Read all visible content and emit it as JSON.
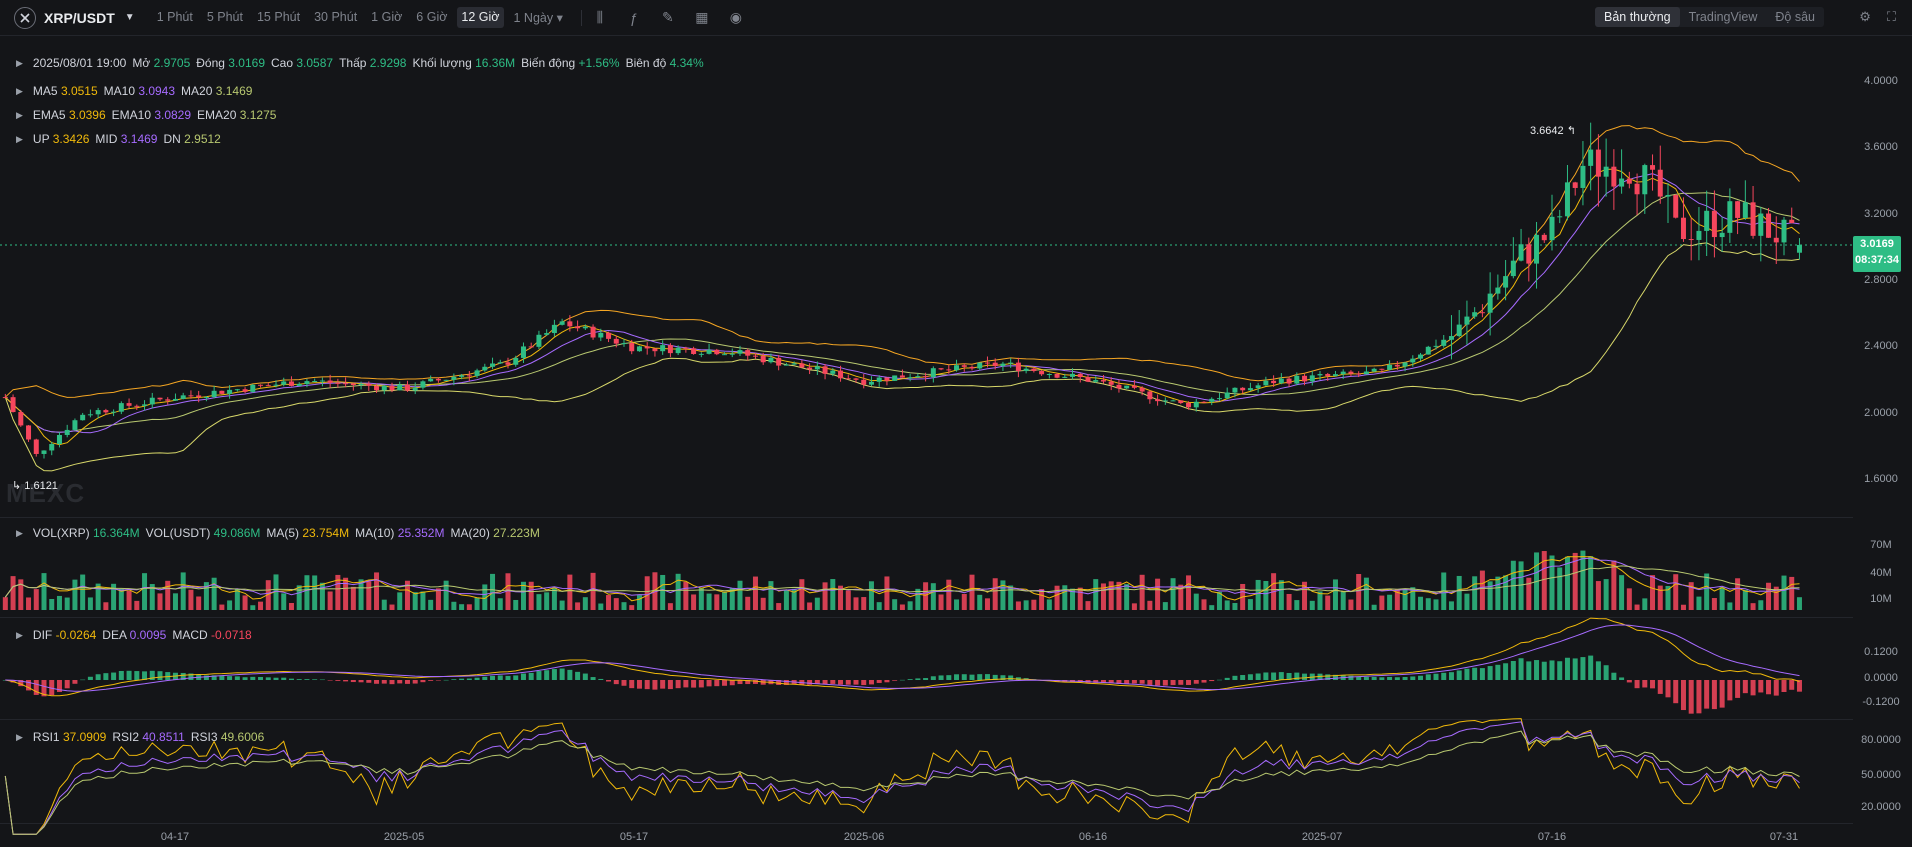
{
  "header": {
    "pair": "XRP/USDT",
    "intervals": [
      "1 Phút",
      "5 Phút",
      "15 Phút",
      "30 Phút",
      "1 Giờ",
      "6 Giờ",
      "12 Giờ",
      "1 Ngày"
    ],
    "active_interval": "12 Giờ",
    "modes": [
      "Bản thường",
      "TradingView",
      "Độ sâu"
    ],
    "active_mode": "Bản thường"
  },
  "ohlc": {
    "date": "2025/08/01 19:00",
    "open_label": "Mở",
    "open": "2.9705",
    "close_label": "Đóng",
    "close": "3.0169",
    "high_label": "Cao",
    "high": "3.0587",
    "low_label": "Thấp",
    "low": "2.9298",
    "vol_label": "Khối lượng",
    "vol": "16.36M",
    "change_label": "Biến động",
    "change": "+1.56%",
    "amp_label": "Biên độ",
    "amp": "4.34%"
  },
  "ma": {
    "ma5": "3.0515",
    "ma10": "3.0943",
    "ma20": "3.1469"
  },
  "ema": {
    "ema5": "3.0396",
    "ema10": "3.0829",
    "ema20": "3.1275"
  },
  "boll": {
    "up": "3.3426",
    "mid": "3.1469",
    "dn": "2.9512"
  },
  "price_axis": [
    "4.0000",
    "3.6000",
    "3.2000",
    "2.8000",
    "2.4000",
    "2.0000",
    "1.6000"
  ],
  "current_price": "3.0169",
  "countdown": "08:37:34",
  "extremes": {
    "high": "3.6642",
    "low": "1.6121"
  },
  "watermark": "MEXC",
  "volume": {
    "vol_coin_label": "VOL(XRP)",
    "vol_coin": "16.364M",
    "vol_usdt_label": "VOL(USDT)",
    "vol_usdt": "49.086M",
    "ma5": "23.754M",
    "ma10": "25.352M",
    "ma20": "27.223M",
    "axis": [
      "70M",
      "40M",
      "10M"
    ]
  },
  "macd": {
    "dif": "-0.0264",
    "dea": "0.0095",
    "macd": "-0.0718",
    "axis": [
      "0.1200",
      "0.0000",
      "-0.1200"
    ]
  },
  "rsi": {
    "rsi1": "37.0909",
    "rsi2": "40.8511",
    "rsi3": "49.6006",
    "axis": [
      "80.0000",
      "50.0000",
      "20.0000"
    ]
  },
  "x_axis": [
    "04-17",
    "2025-05",
    "05-17",
    "2025-06",
    "06-16",
    "2025-07",
    "07-16",
    "07-31"
  ],
  "chart_data": {
    "type": "candlestick",
    "x_ticks": [
      "04-17",
      "2025-05",
      "05-17",
      "2025-06",
      "06-16",
      "2025-07",
      "07-16",
      "07-31"
    ],
    "price_range": [
      1.5,
      4.15
    ],
    "anchors": [
      {
        "x": "04-07",
        "close": 2.1
      },
      {
        "x": "04-09",
        "close": 1.75
      },
      {
        "x": "04-12",
        "close": 2.0
      },
      {
        "x": "04-17",
        "close": 2.1
      },
      {
        "x": "04-25",
        "close": 2.2
      },
      {
        "x": "05-01",
        "close": 2.15
      },
      {
        "x": "05-08",
        "close": 2.3
      },
      {
        "x": "05-12",
        "close": 2.55
      },
      {
        "x": "05-17",
        "close": 2.4
      },
      {
        "x": "05-23",
        "close": 2.38
      },
      {
        "x": "06-01",
        "close": 2.2
      },
      {
        "x": "06-10",
        "close": 2.3
      },
      {
        "x": "06-16",
        "close": 2.2
      },
      {
        "x": "06-22",
        "close": 2.05
      },
      {
        "x": "06-28",
        "close": 2.2
      },
      {
        "x": "07-05",
        "close": 2.25
      },
      {
        "x": "07-10",
        "close": 2.5
      },
      {
        "x": "07-14",
        "close": 2.95
      },
      {
        "x": "07-16",
        "close": 3.1
      },
      {
        "x": "07-18",
        "close": 3.5
      },
      {
        "x": "07-21",
        "close": 3.5
      },
      {
        "x": "07-23",
        "close": 3.3
      },
      {
        "x": "07-24",
        "close": 3.1
      },
      {
        "x": "07-28",
        "close": 3.2
      },
      {
        "x": "08-01",
        "close": 3.0169
      }
    ]
  },
  "colors": {
    "up": "#2ebd85",
    "down": "#f6465d",
    "ma5": "#f0b90b",
    "ma10": "#a66bff",
    "ma20": "#b8c870",
    "boll": "#f5a623"
  }
}
